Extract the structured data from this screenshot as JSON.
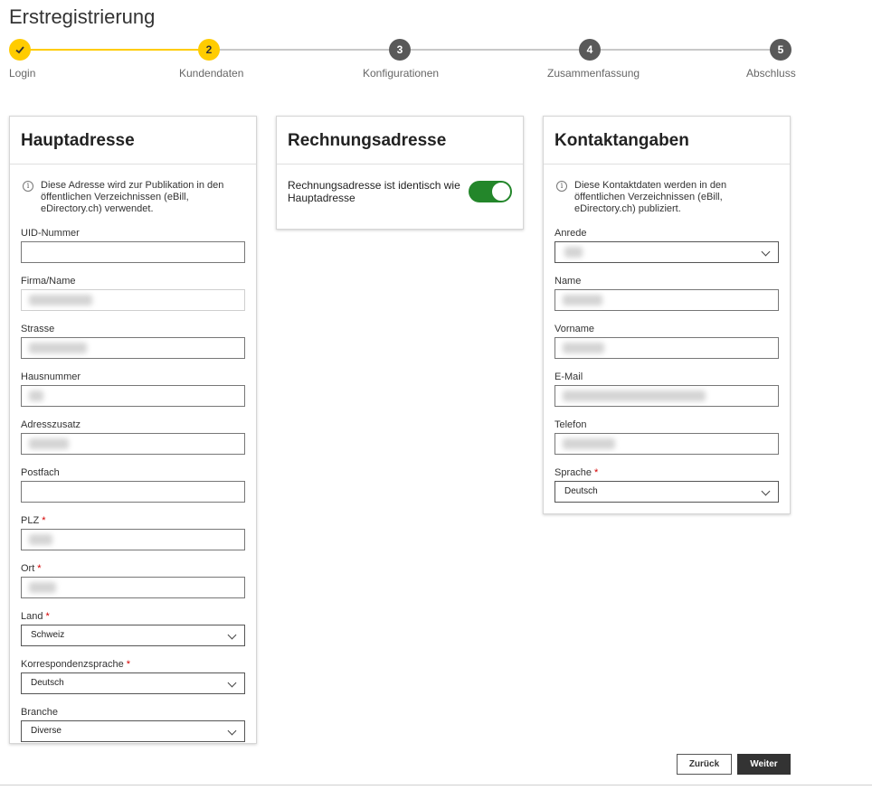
{
  "page_title": "Erstregistrierung",
  "stepper": [
    {
      "label": "Login",
      "number": "",
      "state": "done"
    },
    {
      "label": "Kundendaten",
      "number": "2",
      "state": "active"
    },
    {
      "label": "Konfigurationen",
      "number": "3",
      "state": "future"
    },
    {
      "label": "Zusammenfassung",
      "number": "4",
      "state": "future"
    },
    {
      "label": "Abschluss",
      "number": "5",
      "state": "future"
    }
  ],
  "main_address": {
    "title": "Hauptadresse",
    "info": "Diese Adresse wird zur Publikation in den öffentlichen Verzeichnissen (eBill, eDirectory.ch) verwendet.",
    "fields": {
      "uid": {
        "label": "UID-Nummer",
        "value": ""
      },
      "company": {
        "label": "Firma/Name"
      },
      "street": {
        "label": "Strasse"
      },
      "house_number": {
        "label": "Hausnummer"
      },
      "address_extra": {
        "label": "Adresszusatz"
      },
      "po_box": {
        "label": "Postfach",
        "value": ""
      },
      "zip": {
        "label": "PLZ",
        "required": "*"
      },
      "city": {
        "label": "Ort",
        "required": "*"
      },
      "country": {
        "label": "Land",
        "required": "*",
        "value": "Schweiz"
      },
      "correspondence_language": {
        "label": "Korrespondenzsprache",
        "required": "*",
        "value": "Deutsch"
      },
      "industry": {
        "label": "Branche",
        "value": "Diverse"
      }
    }
  },
  "billing_address": {
    "title": "Rechnungsadresse",
    "toggle_label": "Rechnungsadresse ist identisch wie Hauptadresse"
  },
  "contact": {
    "title": "Kontaktangaben",
    "info": "Diese Kontaktdaten werden in den öffentlichen Verzeichnissen (eBill, eDirectory.ch) publiziert.",
    "fields": {
      "salutation": {
        "label": "Anrede"
      },
      "name": {
        "label": "Name"
      },
      "first_name": {
        "label": "Vorname"
      },
      "email": {
        "label": "E-Mail"
      },
      "phone": {
        "label": "Telefon"
      },
      "language": {
        "label": "Sprache",
        "required": "*",
        "value": "Deutsch"
      }
    }
  },
  "buttons": {
    "back": "Zurück",
    "next": "Weiter"
  },
  "colors": {
    "accent": "#ffcc00",
    "toggle_on": "#23862a",
    "required": "#d40000",
    "primary_button": "#333333"
  }
}
